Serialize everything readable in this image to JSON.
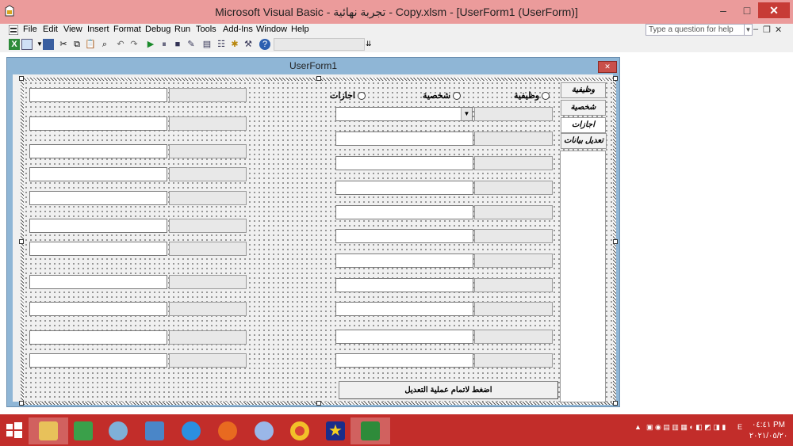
{
  "window": {
    "title": "Microsoft Visual Basic - تجربة نهائية - Copy.xlsm - [UserForm1 (UserForm)]",
    "minimize": "–",
    "maximize": "□",
    "close": "✕"
  },
  "menu": [
    "File",
    "Edit",
    "View",
    "Insert",
    "Format",
    "Debug",
    "Run",
    "Tools",
    "Add-Ins",
    "Window",
    "Help"
  ],
  "help_box": {
    "placeholder": "Type a question for help"
  },
  "mdi_controls": {
    "minimize": "–",
    "restore": "❐",
    "close": "✕"
  },
  "toolbar": {
    "icons": [
      "excel-icon",
      "insert-userform-icon",
      "save-icon",
      "cut-icon",
      "copy-icon",
      "paste-icon",
      "find-icon",
      "undo-icon",
      "redo-icon",
      "run-icon",
      "break-icon",
      "reset-icon",
      "design-mode-icon",
      "project-explorer-icon",
      "properties-icon",
      "object-browser-icon",
      "toolbox-icon",
      "help-icon"
    ]
  },
  "userform": {
    "title": "UserForm1",
    "close": "✕",
    "options": [
      "وظيفية",
      "شخصية",
      "اجازات"
    ],
    "tabs": [
      "وظيفية",
      "شخصية",
      "اجازات",
      "تعديل بيانات"
    ],
    "submit_label": "اضغط لاتمام عملية  التعديل"
  },
  "taskbar": {
    "apps": [
      "windows-start-icon",
      "file-explorer-icon",
      "calculator-icon",
      "paint-icon",
      "app-icon",
      "internet-explorer-icon",
      "firefox-icon",
      "browser-icon",
      "chrome-icon",
      "star-app-icon",
      "excel-icon"
    ]
  },
  "clock": {
    "time": "٠٤:٤١ PM",
    "date": "٢٠٢١/٠٥/٢٠",
    "lang": "E"
  },
  "colors": {
    "titlebar": "#eb9b9b",
    "taskbar": "#c22d2a",
    "close": "#c73b36"
  }
}
